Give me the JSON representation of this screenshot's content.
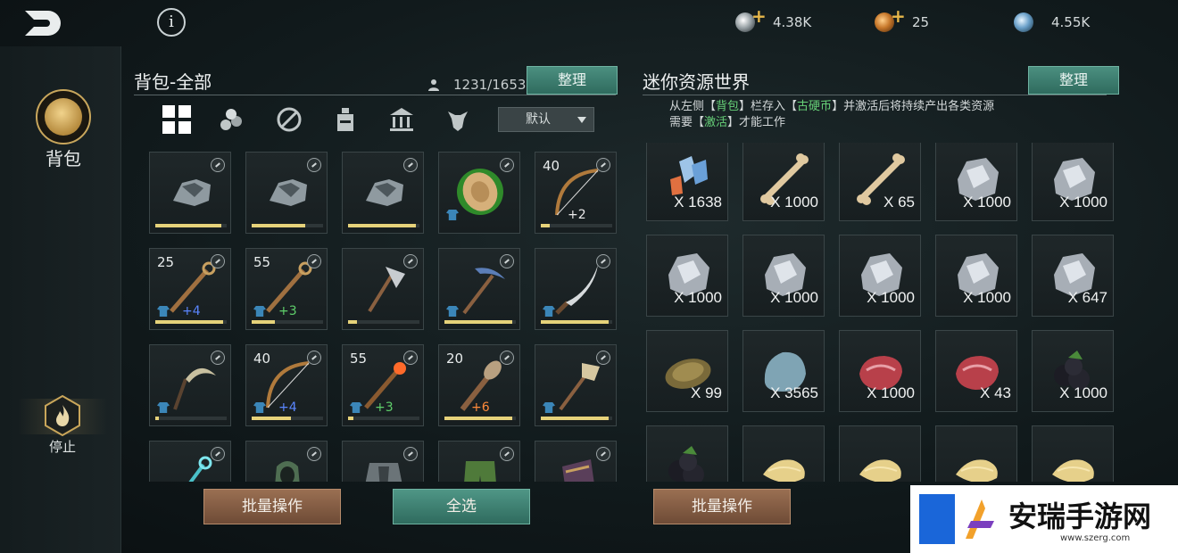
{
  "topbar": {
    "back_icon": "back-arrow-icon",
    "info_label": "i",
    "currencies": [
      {
        "name": "silver",
        "value": "4.38K",
        "has_plus": true
      },
      {
        "name": "bronze",
        "value": "25",
        "has_plus": true
      },
      {
        "name": "orb",
        "value": "4.55K",
        "has_plus": false
      }
    ]
  },
  "sidebar": {
    "bag_label": "背包",
    "stop_label": "停止"
  },
  "left_panel": {
    "title": "背包-全部",
    "capacity": "1231/1653",
    "sort_button": "整理",
    "dropdown": "默认",
    "filters": [
      "all-grid-icon",
      "wood-logs-icon",
      "weapon-crossed-icon",
      "potion-icon",
      "building-icon",
      "creature-icon"
    ],
    "items": [
      {
        "lvl": "",
        "bar": 0.92,
        "shirt": false,
        "plus": "",
        "plus_color": "",
        "art": "armor"
      },
      {
        "lvl": "",
        "bar": 0.75,
        "shirt": false,
        "plus": "",
        "plus_color": "",
        "art": "armor"
      },
      {
        "lvl": "",
        "bar": 0.95,
        "shirt": false,
        "plus": "",
        "plus_color": "",
        "art": "armor"
      },
      {
        "lvl": "",
        "bar": 0,
        "shirt": true,
        "plus": "",
        "plus_color": "",
        "art": "coin-green"
      },
      {
        "lvl": "40",
        "bar": 0.12,
        "shirt": false,
        "plus": "+2",
        "plus_color": "white",
        "art": "bow"
      },
      {
        "lvl": "25",
        "bar": 0.95,
        "shirt": true,
        "plus": "+4",
        "plus_color": "blue",
        "art": "staff"
      },
      {
        "lvl": "55",
        "bar": 0.32,
        "shirt": true,
        "plus": "+3",
        "plus_color": "green",
        "art": "staff"
      },
      {
        "lvl": "",
        "bar": 0.12,
        "shirt": false,
        "plus": "",
        "plus_color": "",
        "art": "axe"
      },
      {
        "lvl": "",
        "bar": 0.95,
        "shirt": true,
        "plus": "",
        "plus_color": "",
        "art": "pickaxe"
      },
      {
        "lvl": "",
        "bar": 0.95,
        "shirt": true,
        "plus": "",
        "plus_color": "",
        "art": "blade"
      },
      {
        "lvl": "",
        "bar": 0.05,
        "shirt": true,
        "plus": "",
        "plus_color": "",
        "art": "sickle"
      },
      {
        "lvl": "40",
        "bar": 0.55,
        "shirt": true,
        "plus": "+4",
        "plus_color": "blue",
        "art": "bow"
      },
      {
        "lvl": "55",
        "bar": 0.08,
        "shirt": true,
        "plus": "+3",
        "plus_color": "green",
        "art": "staff-orange"
      },
      {
        "lvl": "20",
        "bar": 0.95,
        "shirt": false,
        "plus": "+6",
        "plus_color": "orange",
        "art": "club"
      },
      {
        "lvl": "",
        "bar": 0.95,
        "shirt": true,
        "plus": "",
        "plus_color": "",
        "art": "shovel"
      },
      {
        "lvl": "",
        "bar": 0,
        "shirt": false,
        "plus": "",
        "plus_color": "",
        "art": "staff-cyan"
      },
      {
        "lvl": "",
        "bar": 0,
        "shirt": false,
        "plus": "",
        "plus_color": "",
        "art": "hood"
      },
      {
        "lvl": "",
        "bar": 0,
        "shirt": false,
        "plus": "",
        "plus_color": "",
        "art": "armor-dark"
      },
      {
        "lvl": "",
        "bar": 0,
        "shirt": false,
        "plus": "",
        "plus_color": "",
        "art": "pants"
      },
      {
        "lvl": "",
        "bar": 0,
        "shirt": false,
        "plus": "",
        "plus_color": "",
        "art": "bracer"
      }
    ],
    "batch_button": "批量操作",
    "select_all_button": "全选"
  },
  "right_panel": {
    "title": "迷你资源世界",
    "sort_button": "整理",
    "desc_line1_a": "从左侧【",
    "desc_line1_b": "背包",
    "desc_line1_c": "】栏存入【",
    "desc_line1_d": "古硬币",
    "desc_line1_e": "】并激活后将持续产出各类资源",
    "desc_line2_a": "需要【",
    "desc_line2_b": "激活",
    "desc_line2_c": "】才能工作",
    "resources": [
      {
        "qty": "X 1638",
        "art": "crystal"
      },
      {
        "qty": "X 1000",
        "art": "bone"
      },
      {
        "qty": "X 65",
        "art": "bone"
      },
      {
        "qty": "X 1000",
        "art": "ore"
      },
      {
        "qty": "X 1000",
        "art": "ore"
      },
      {
        "qty": "X 1000",
        "art": "ore"
      },
      {
        "qty": "X 1000",
        "art": "ore"
      },
      {
        "qty": "X 1000",
        "art": "ore"
      },
      {
        "qty": "X 1000",
        "art": "ore"
      },
      {
        "qty": "X 647",
        "art": "ore"
      },
      {
        "qty": "X 99",
        "art": "shell"
      },
      {
        "qty": "X 3565",
        "art": "stone"
      },
      {
        "qty": "X 1000",
        "art": "meat"
      },
      {
        "qty": "X 43",
        "art": "meat"
      },
      {
        "qty": "X 1000",
        "art": "berry"
      },
      {
        "qty": "",
        "art": "berry"
      },
      {
        "qty": "",
        "art": "fiber"
      },
      {
        "qty": "",
        "art": "fiber"
      },
      {
        "qty": "",
        "art": "fiber"
      },
      {
        "qty": "",
        "art": "fiber"
      }
    ],
    "batch_button": "批量操作"
  },
  "watermark": {
    "text": "安瑞手游网",
    "url": "www.szerg.com"
  }
}
